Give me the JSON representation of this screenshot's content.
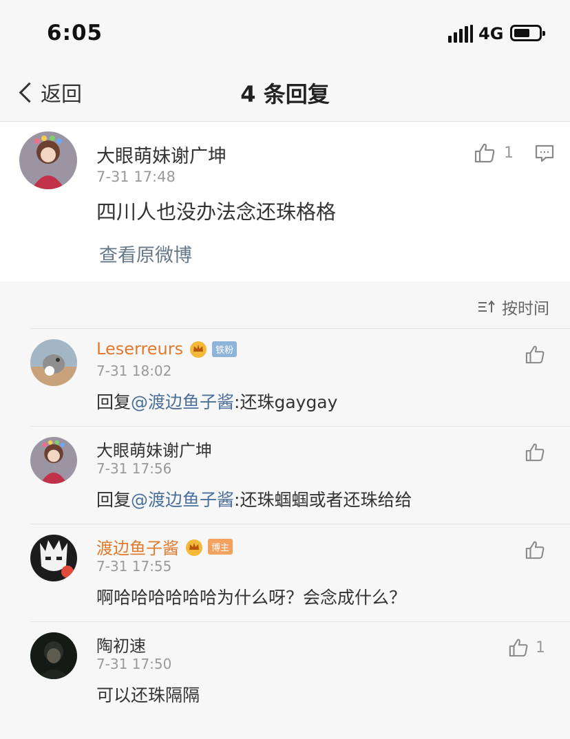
{
  "status": {
    "time": "6:05",
    "network": "4G"
  },
  "nav": {
    "back_label": "返回",
    "title": "4 条回复"
  },
  "main_comment": {
    "author": "大眼萌妹谢广坤",
    "time": "7-31 17:48",
    "text": "四川人也没办法念还珠格格",
    "likes": "1",
    "link": "查看原微博"
  },
  "sort": {
    "label": "按时间"
  },
  "replies": [
    {
      "author": "Leserreurs",
      "badge": "铁粉",
      "time": "7-31 18:02",
      "prefix": "回复",
      "mention": "@渡边鱼子酱",
      "text": ":还珠gaygay",
      "likes": ""
    },
    {
      "author": "大眼萌妹谢广坤",
      "badge": "",
      "time": "7-31 17:56",
      "prefix": "回复",
      "mention": "@渡边鱼子酱",
      "text": ":还珠蝈蝈或者还珠给给",
      "likes": ""
    },
    {
      "author": "渡边鱼子酱",
      "badge": "博主",
      "time": "7-31 17:55",
      "prefix": "",
      "mention": "",
      "text": "啊哈哈哈哈哈哈为什么呀？会念成什么？",
      "likes": ""
    },
    {
      "author": "陶初速",
      "badge": "",
      "time": "7-31 17:50",
      "prefix": "",
      "mention": "",
      "text": "可以还珠隔隔",
      "likes": "1"
    }
  ],
  "colors": {
    "vip_name": "#e07a2e",
    "mention": "#4a6f9a",
    "badge_fan": "#8fb4d9",
    "badge_host": "#f2a15f"
  }
}
